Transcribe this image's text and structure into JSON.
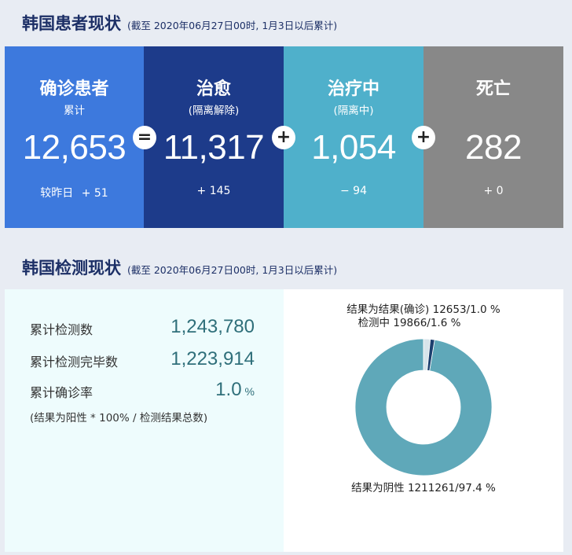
{
  "patient_section": {
    "title": "韩国患者现状",
    "note": "(截至 2020年06月27日00时, 1月3日以后累计)"
  },
  "cards": [
    {
      "title": "确诊患者",
      "sub": "累计",
      "number": "12,653",
      "delta_label": "较昨日",
      "delta": "+ 51"
    },
    {
      "title": "治愈",
      "sub": "(隔离解除)",
      "number": "11,317",
      "delta_label": "",
      "delta": "+ 145"
    },
    {
      "title": "治疗中",
      "sub": "(隔离中)",
      "number": "1,054",
      "delta_label": "",
      "delta": "− 94"
    },
    {
      "title": "死亡",
      "sub": "",
      "number": "282",
      "delta_label": "",
      "delta": "+ 0"
    }
  ],
  "operators": [
    "=",
    "+",
    "+"
  ],
  "test_section": {
    "title": "韩国检测现状",
    "note": "(截至 2020年06月27日00时, 1月3日以后累计)",
    "stats": [
      {
        "label": "累计检测数",
        "value": "1,243,780",
        "unit": ""
      },
      {
        "label": "累计检测完毕数",
        "value": "1,223,914",
        "unit": ""
      },
      {
        "label": "累计确诊率",
        "value": "1.0",
        "unit": "%"
      }
    ],
    "formula": "(结果为阳性 * 100% / 检测结果总数)"
  },
  "colors": {
    "confirmed": "#3d79dd",
    "cured": "#1d3b8a",
    "treating": "#4fb0cb",
    "deceased": "#888888",
    "donut_negative": "#5fa8b9",
    "donut_testing": "#d7e4ea",
    "donut_positive": "#1c3f6e"
  },
  "chart_data": {
    "type": "pie",
    "donut": true,
    "slices": [
      {
        "name": "结果为阴性",
        "value": 1211261,
        "percent": 97.4,
        "label": "结果为阴性 1211261/97.4 %"
      },
      {
        "name": "检测中",
        "value": 19866,
        "percent": 1.6,
        "label": "检测中 19866/1.6 %"
      },
      {
        "name": "结果为结果(确诊)",
        "value": 12653,
        "percent": 1.0,
        "label": "结果为结果(确诊) 12653/1.0 %"
      }
    ]
  }
}
